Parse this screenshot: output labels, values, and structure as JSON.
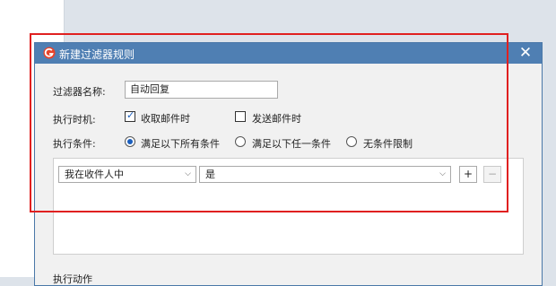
{
  "dialog": {
    "title": "新建过滤器规则",
    "close_glyph": "✕"
  },
  "form": {
    "name_label": "过滤器名称:",
    "name_value": "自动回复",
    "timing_label": "执行时机:",
    "timing_options": [
      {
        "label": "收取邮件时",
        "checked": true
      },
      {
        "label": "发送邮件时",
        "checked": false
      }
    ],
    "condition_label": "执行条件:",
    "condition_options": [
      {
        "label": "满足以下所有条件",
        "selected": true
      },
      {
        "label": "满足以下任一条件",
        "selected": false
      },
      {
        "label": "无条件限制",
        "selected": false
      }
    ]
  },
  "rule_row": {
    "field_value": "我在收件人中",
    "operator_value": "是",
    "add_label": "+",
    "remove_label": "−"
  },
  "actions_label_partial": "执行动作",
  "colors": {
    "titlebar": "#4f7fb3",
    "highlight": "#e02020",
    "accent": "#1a5ebd"
  }
}
